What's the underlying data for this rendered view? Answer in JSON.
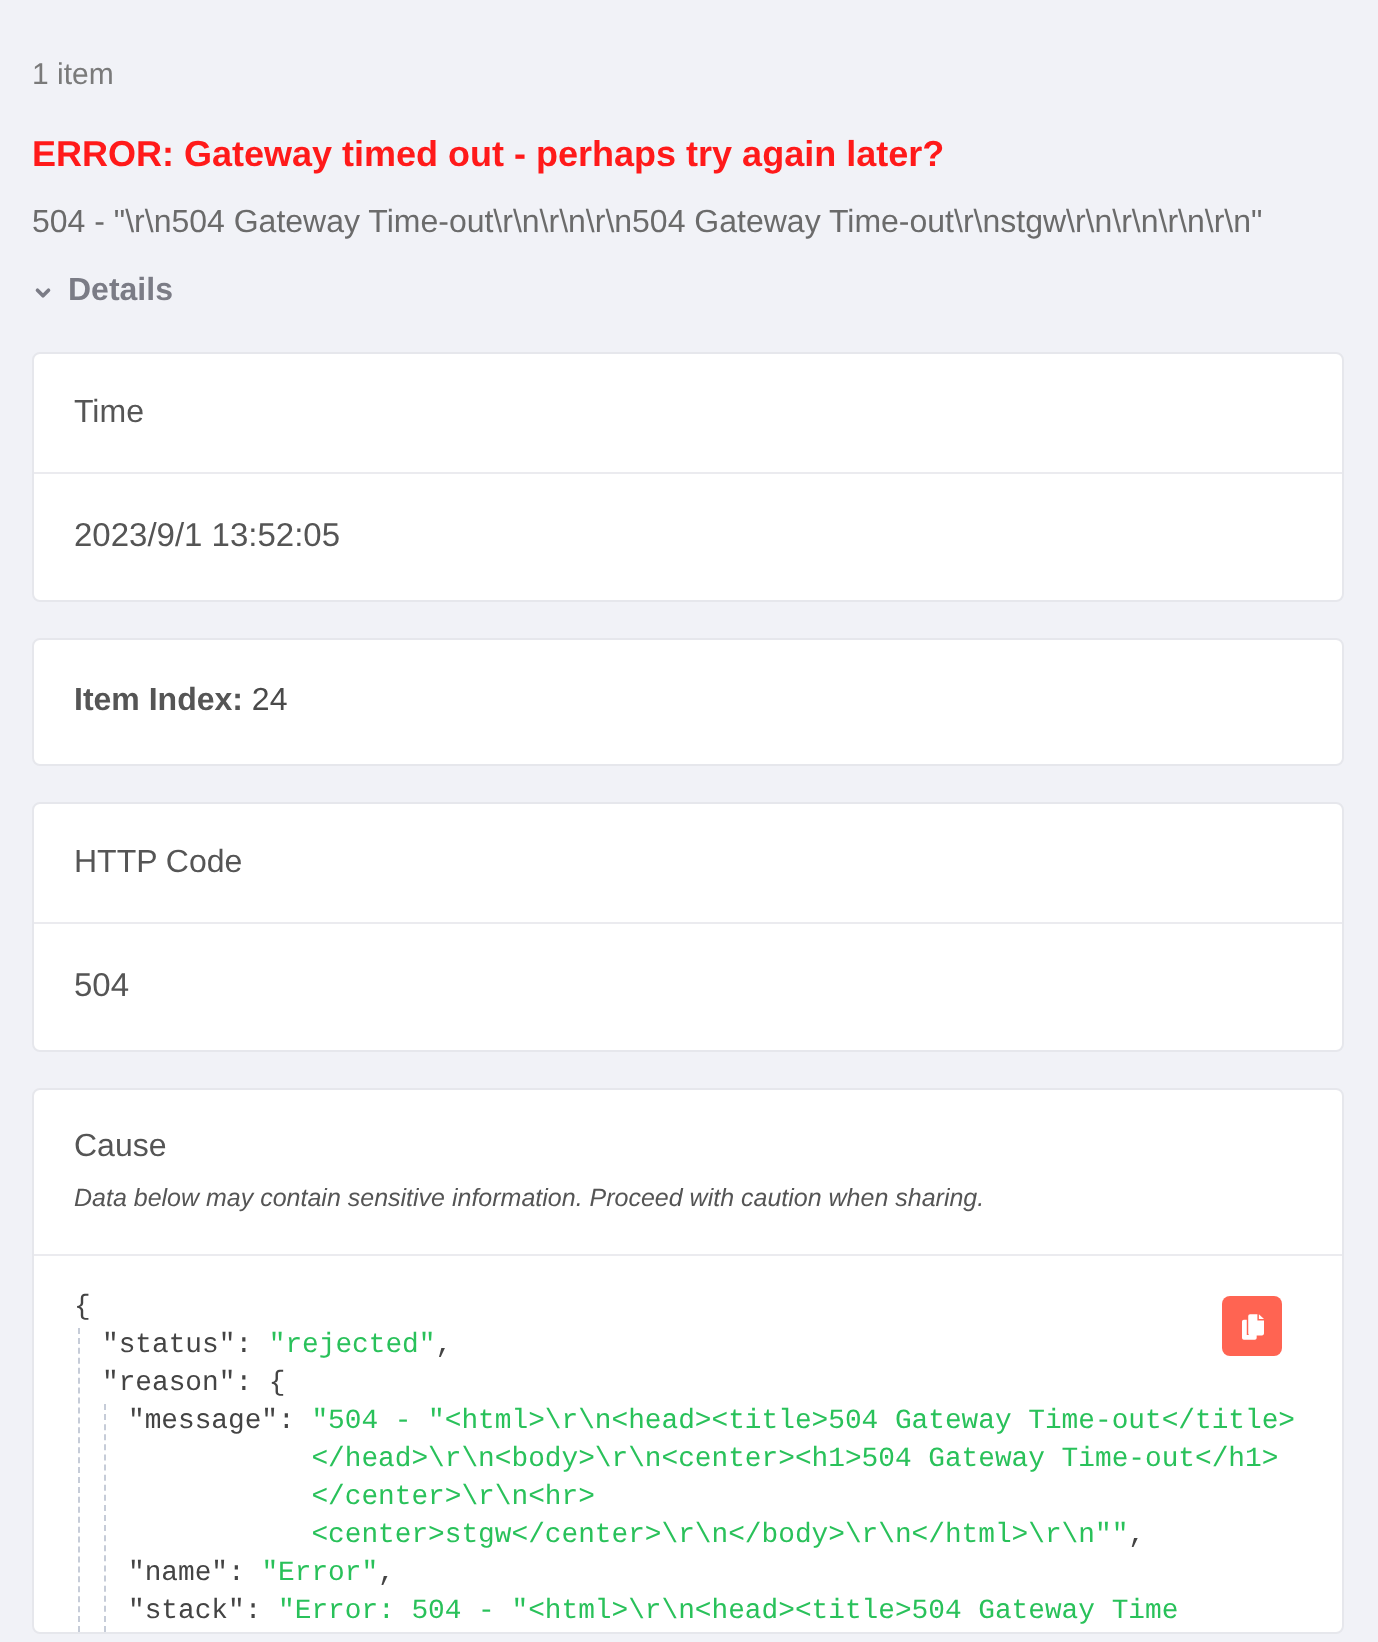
{
  "summary": {
    "count": "1 item",
    "error_title": "ERROR: Gateway timed out - perhaps try again later?",
    "error_message": "504 - \"\\r\\n504 Gateway Time-out\\r\\n\\r\\n\\r\\n504 Gateway Time-out\\r\\nstgw\\r\\n\\r\\n\\r\\n\\r\\n\""
  },
  "details": {
    "label": "Details",
    "expanded": true
  },
  "cards": [
    {
      "kind": "split",
      "title": "Time",
      "value": "2023/9/1 13:52:05"
    },
    {
      "kind": "inline",
      "text": "**Item Index:** 24"
    },
    {
      "kind": "split",
      "title": "HTTP Code",
      "value": "504"
    },
    {
      "kind": "code",
      "title": "Cause",
      "note": "Data below may contain sensitive information. Proceed with caution when sharing.",
      "code": {
        "open": "{",
        "children": [
          {
            "key": "\"status\"",
            "sep": ": ",
            "value": "\"rejected\"",
            "end": ","
          },
          {
            "key": "\"reason\"",
            "sep": ": ",
            "open": "{",
            "children": [
              {
                "key": "\"message\"",
                "sep": ": ",
                "value": "\"504 - \"<html>\\r\\n<head><title>504 Gateway Time-out</title>\n</head>\\r\\n<body>\\r\\n<center><h1>504 Gateway Time-out</h1>\n</center>\\r\\n<hr>\n<center>stgw</center>\\r\\n</body>\\r\\n</html>\\r\\n\"\"",
                "end": ","
              },
              {
                "key": "\"name\"",
                "sep": ": ",
                "value": "\"Error\"",
                "end": ","
              },
              {
                "key": "\"stack\"",
                "sep": ": ",
                "value": "\"Error: 504 - \"<html>\\r\\n<head><title>504 Gateway Time"
              }
            ]
          }
        ]
      }
    }
  ]
}
